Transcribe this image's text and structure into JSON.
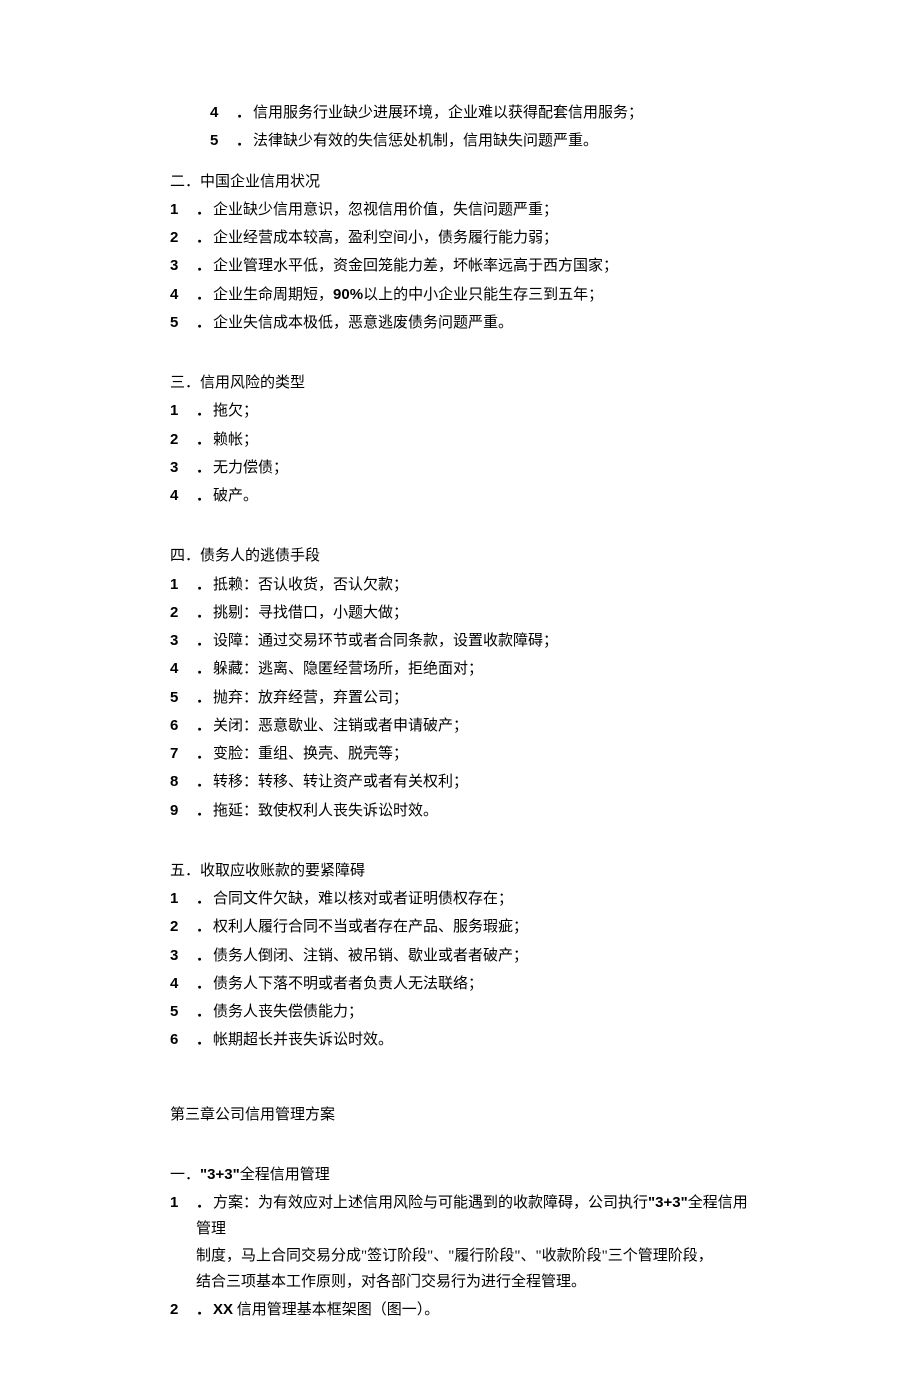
{
  "sec1_sub": [
    {
      "n": "4",
      "t": "信用服务行业缺少进展环境，企业难以获得配套信用服务；"
    },
    {
      "n": "5",
      "t": "法律缺少有效的失信惩处机制，信用缺失问题严重。"
    }
  ],
  "sec2_title": "二．中国企业信用状况",
  "sec2": [
    {
      "n": "1",
      "t": "企业缺少信用意识，忽视信用价值，失信问题严重；"
    },
    {
      "n": "2",
      "t": "企业经营成本较高，盈利空间小，债务履行能力弱；"
    },
    {
      "n": "3",
      "t": "企业管理水平低，资金回笼能力差，坏帐率远高于西方国家；"
    },
    {
      "n": "4",
      "pre": "企业生命周期短，",
      "bold": "90%",
      "post": "以上的中小企业只能生存三到五年；"
    },
    {
      "n": "5",
      "t": "企业失信成本极低，恶意逃废债务问题严重。"
    }
  ],
  "sec3_title": "三．信用风险的类型",
  "sec3": [
    {
      "n": "1",
      "t": "拖欠；"
    },
    {
      "n": "2",
      "t": "赖帐；"
    },
    {
      "n": "3",
      "t": "无力偿债；"
    },
    {
      "n": "4",
      "t": "破产。"
    }
  ],
  "sec4_title": "四．债务人的逃债手段",
  "sec4": [
    {
      "n": "1",
      "t": "抵赖：否认收货，否认欠款；"
    },
    {
      "n": "2",
      "t": "挑剔：寻找借口，小题大做；"
    },
    {
      "n": "3",
      "t": "设障：通过交易环节或者合同条款，设置收款障碍；"
    },
    {
      "n": "4",
      "t": "躲藏：逃离、隐匿经营场所，拒绝面对；"
    },
    {
      "n": "5",
      "t": "抛弃：放弃经营，弃置公司；"
    },
    {
      "n": "6",
      "t": "关闭：恶意歇业、注销或者申请破产；"
    },
    {
      "n": "7",
      "t": "变脸：重组、换壳、脱壳等；"
    },
    {
      "n": "8",
      "t": "转移：转移、转让资产或者有关权利；"
    },
    {
      "n": "9",
      "t": "拖延：致使权利人丧失诉讼时效。"
    }
  ],
  "sec5_title": "五．收取应收账款的要紧障碍",
  "sec5": [
    {
      "n": "1",
      "t": "合同文件欠缺，难以核对或者证明债权存在；"
    },
    {
      "n": "2",
      "t": "权利人履行合同不当或者存在产品、服务瑕疵；"
    },
    {
      "n": "3",
      "t": "债务人倒闭、注销、被吊销、歇业或者者破产；"
    },
    {
      "n": "4",
      "t": "债务人下落不明或者者负责人无法联络；"
    },
    {
      "n": "5",
      "t": "债务人丧失偿债能力；"
    },
    {
      "n": "6",
      "t": "帐期超长并丧失诉讼时效。"
    }
  ],
  "chapter3_title": "第三章公司信用管理方案",
  "chapter3_sec1_title_pre": "一．",
  "chapter3_sec1_title_bold": "\"3+3\"",
  "chapter3_sec1_title_post": "全程信用管理",
  "chapter3_sec1": [
    {
      "n": "1",
      "line1_pre": "方案：为有效应对上述信用风险与可能遇到的收款障碍，公司执行",
      "line1_bold": "\"3+3\"",
      "line1_post": "全程信用管理",
      "line2": "制度，马上合同交易分成\"签订阶段\"、\"履行阶段\"、\"收款阶段\"三个管理阶段，",
      "line3": "结合三项基本工作原则，对各部门交易行为进行全程管理。"
    },
    {
      "n": "2",
      "bold": "XX",
      "post": " 信用管理基本框架图（图一）。"
    }
  ]
}
